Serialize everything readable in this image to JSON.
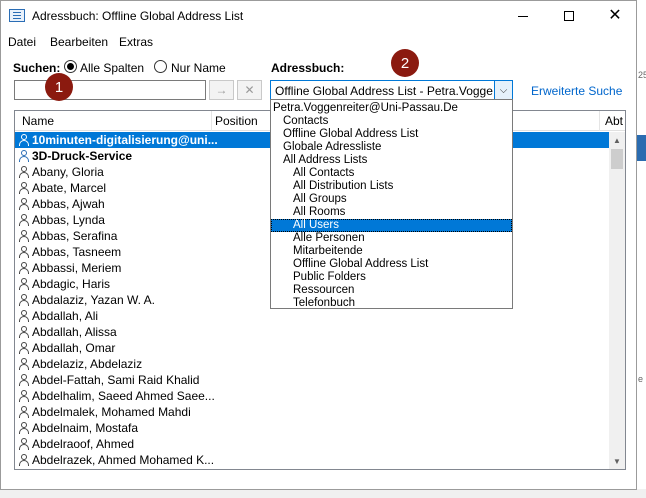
{
  "window": {
    "title": "Adressbuch: Offline Global Address List",
    "icon": "address-book-icon"
  },
  "menubar": [
    "Datei",
    "Bearbeiten",
    "Extras"
  ],
  "search": {
    "label": "Suchen:",
    "radio_all": "Alle Spalten",
    "radio_name": "Nur Name",
    "selected_radio": "all",
    "value": "",
    "go_glyph": "→",
    "clear_glyph": "✕"
  },
  "addressbook": {
    "label": "Adressbuch:",
    "selected": "Offline Global Address List - Petra.Voggenreiter@Uni-Passau.De",
    "advanced_search": "Erweiterte Suche"
  },
  "badges": [
    "1",
    "2"
  ],
  "list": {
    "columns": [
      "Name",
      "Position",
      "Abt"
    ],
    "rows": [
      {
        "name": "10minuten-digitalisierung@uni...",
        "icon": "group-icon",
        "bold": true,
        "selected": true
      },
      {
        "name": "3D-Druck-Service",
        "icon": "group-icon",
        "bold": true,
        "selected": false
      },
      {
        "name": "Abany, Gloria",
        "icon": "person-icon"
      },
      {
        "name": "Abate, Marcel",
        "icon": "person-icon"
      },
      {
        "name": "Abbas, Ajwah",
        "icon": "person-icon"
      },
      {
        "name": "Abbas, Lynda",
        "icon": "person-icon"
      },
      {
        "name": "Abbas, Serafina",
        "icon": "person-icon"
      },
      {
        "name": "Abbas, Tasneem",
        "icon": "person-icon"
      },
      {
        "name": "Abbassi, Meriem",
        "icon": "person-icon"
      },
      {
        "name": "Abdagic, Haris",
        "icon": "person-icon"
      },
      {
        "name": "Abdalaziz, Yazan W. A.",
        "icon": "person-icon"
      },
      {
        "name": "Abdallah, Ali",
        "icon": "person-icon"
      },
      {
        "name": "Abdallah, Alissa",
        "icon": "person-icon"
      },
      {
        "name": "Abdallah, Omar",
        "icon": "person-icon"
      },
      {
        "name": "Abdelaziz, Abdelaziz",
        "icon": "person-icon"
      },
      {
        "name": "Abdel-Fattah, Sami Raid Khalid",
        "icon": "person-icon"
      },
      {
        "name": "Abdelhalim, Saeed Ahmed Saee...",
        "icon": "person-icon"
      },
      {
        "name": "Abdelmalek, Mohamed Mahdi",
        "icon": "person-icon"
      },
      {
        "name": "Abdelnaim, Mostafa",
        "icon": "person-icon"
      },
      {
        "name": "Abdelraoof, Ahmed",
        "icon": "person-icon"
      },
      {
        "name": "Abdelrazek, Ahmed Mohamed K...",
        "icon": "person-icon"
      }
    ]
  },
  "dropdown": {
    "items": [
      {
        "label": "Petra.Voggenreiter@Uni-Passau.De",
        "level": 0
      },
      {
        "label": "Contacts",
        "level": 1
      },
      {
        "label": "Offline Global Address List",
        "level": 1
      },
      {
        "label": "Globale Adressliste",
        "level": 1
      },
      {
        "label": "All Address Lists",
        "level": 1
      },
      {
        "label": "All Contacts",
        "level": 2
      },
      {
        "label": "All Distribution Lists",
        "level": 2
      },
      {
        "label": "All Groups",
        "level": 2
      },
      {
        "label": "All Rooms",
        "level": 2
      },
      {
        "label": "All Users",
        "level": 2,
        "selected": true
      },
      {
        "label": "Alle Personen",
        "level": 2
      },
      {
        "label": "Mitarbeitende",
        "level": 2
      },
      {
        "label": "Offline Global Address List",
        "level": 2
      },
      {
        "label": "Public Folders",
        "level": 2
      },
      {
        "label": "Ressourcen",
        "level": 2
      },
      {
        "label": "Telefonbuch",
        "level": 2
      }
    ]
  },
  "background": {
    "right_text_1": "25",
    "right_text_2": "e"
  },
  "colors": {
    "accent": "#0078d7",
    "badge": "#8b1a0f",
    "link": "#0066cc"
  }
}
